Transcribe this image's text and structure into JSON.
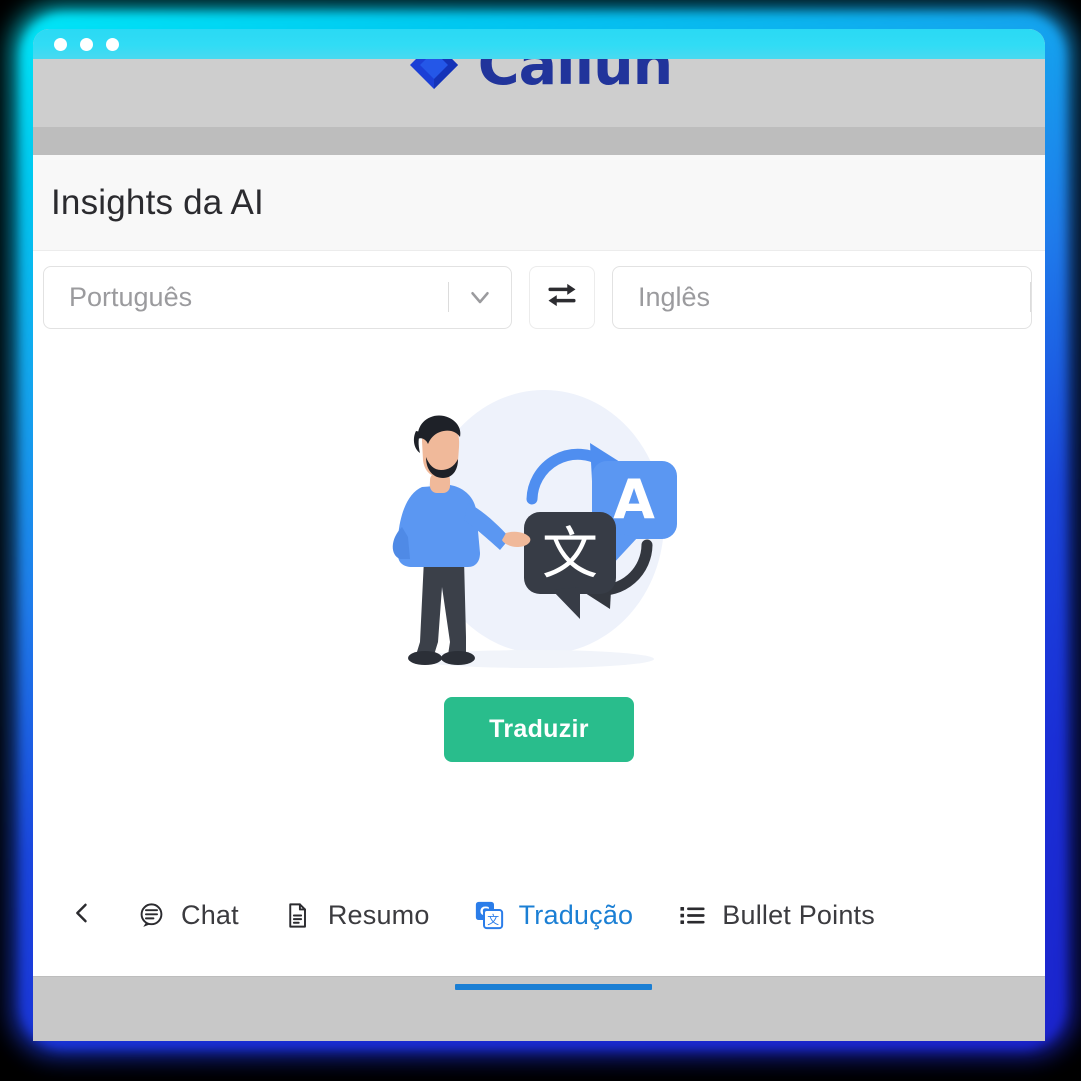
{
  "window": {
    "traffic_lights": [
      "close",
      "minimize",
      "maximize"
    ],
    "brand": {
      "name": "Callun",
      "logo_icon": "diamond-logo-icon",
      "color": "#21349b"
    }
  },
  "header": {
    "title": "Insights da AI"
  },
  "language_bar": {
    "source": {
      "label": "Português",
      "chevron_icon": "chevron-down-icon"
    },
    "swap": {
      "icon": "swap-horizontal-icon",
      "label": "Trocar idiomas"
    },
    "target": {
      "label": "Inglês",
      "chevron_icon": "chevron-down-icon"
    }
  },
  "main": {
    "illustration_name": "translation-illustration",
    "illustration_alt_bubbles": [
      "A",
      "文"
    ],
    "translate_button": {
      "label": "Traduzir",
      "color": "#29bd8c"
    }
  },
  "tabs": {
    "back_icon": "chevron-left-icon",
    "active_color": "#1b7fd4",
    "items": [
      {
        "label": "Chat",
        "icon": "chat-bubble-icon",
        "active": false
      },
      {
        "label": "Resumo",
        "icon": "document-icon",
        "active": false
      },
      {
        "label": "Tradução",
        "icon": "google-translate-icon",
        "active": true
      },
      {
        "label": "Bullet Points",
        "icon": "list-bullets-icon",
        "active": false
      }
    ]
  }
}
